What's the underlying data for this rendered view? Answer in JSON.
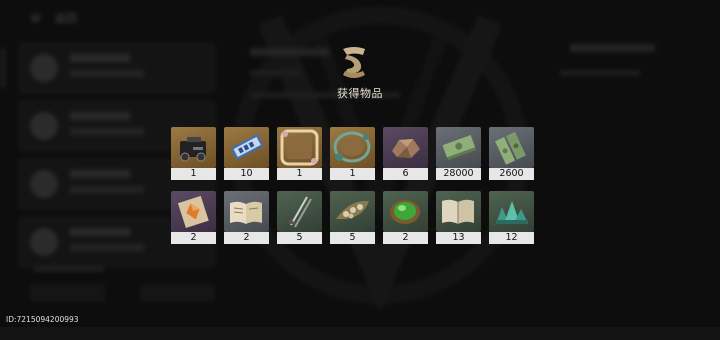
{
  "background": {
    "top_title": "W",
    "top_sub": "返回"
  },
  "popup": {
    "title": "获得物品",
    "rows": [
      [
        {
          "icon": "weapon-kit-icon",
          "count": "1",
          "frame": "bronze"
        },
        {
          "icon": "ticket-scroll-icon",
          "count": "10",
          "frame": "bronze"
        },
        {
          "icon": "ornate-frame-icon",
          "count": "1",
          "frame": "bronze"
        },
        {
          "icon": "leaf-frame-icon",
          "count": "1",
          "frame": "bronze"
        },
        {
          "icon": "ore-chunk-icon",
          "count": "6",
          "frame": "purple"
        },
        {
          "icon": "cash-stack-icon",
          "count": "28000",
          "frame": "gray"
        },
        {
          "icon": "cash-bills-icon",
          "count": "2600",
          "frame": "gray"
        }
      ],
      [
        {
          "icon": "gem-card-icon",
          "count": "2",
          "frame": "purple"
        },
        {
          "icon": "open-book-icon",
          "count": "2",
          "frame": "gray"
        },
        {
          "icon": "blades-icon",
          "count": "5",
          "frame": "green"
        },
        {
          "icon": "seed-pod-icon",
          "count": "5",
          "frame": "green"
        },
        {
          "icon": "green-orb-icon",
          "count": "2",
          "frame": "green"
        },
        {
          "icon": "manual-icon",
          "count": "13",
          "frame": "green"
        },
        {
          "icon": "crystal-cluster-icon",
          "count": "12",
          "frame": "green"
        }
      ]
    ]
  },
  "footer": {
    "uid": "ID:7215094200993"
  }
}
